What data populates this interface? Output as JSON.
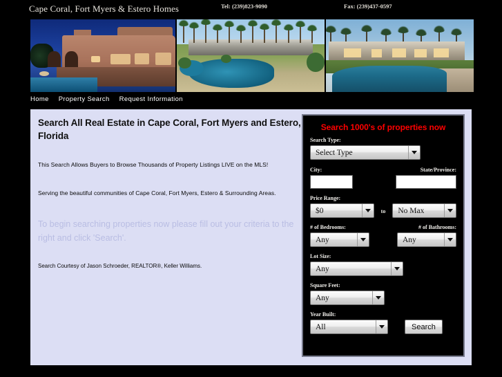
{
  "header": {
    "site_title": "Cape Coral, Fort Myers & Estero Homes",
    "tel": "Tel: (239)823-9090",
    "fax": "Fax: (239)437-0597"
  },
  "banner": {
    "photos": [
      {
        "alt": "adobe-style-home-at-dusk-with-pool"
      },
      {
        "alt": "palm-tree-estate-with-lagoon-pool"
      },
      {
        "alt": "modern-estate-at-twilight-with-lit-pool"
      }
    ]
  },
  "nav": {
    "items": [
      {
        "label": "Home"
      },
      {
        "label": "Property Search"
      },
      {
        "label": "Request Information"
      }
    ]
  },
  "main": {
    "heading": "Search All Real Estate in Cape Coral, Fort Myers and Estero, Florida",
    "line1": "This Search Allows Buyers to Browse Thousands of Property Listings LIVE on the MLS!",
    "line2": "Serving the beautiful communities of Cape Coral, Fort Myers, Estero & Surrounding Areas.",
    "callout": "To begin searching properties now please fill out your criteria to the right and click 'Search'.",
    "courtesy": "Search Courtesy of Jason Schroeder, REALTOR®, Keller Williams."
  },
  "search_form": {
    "title": "Search 1000's of properties now",
    "accent_color": "#ff0000",
    "panel_bg": "#000000",
    "fields": {
      "search_type": {
        "label": "Search Type:",
        "value": "Select Type"
      },
      "city": {
        "label": "City:",
        "value": "",
        "placeholder": ""
      },
      "state": {
        "label": "State/Province:",
        "value": "",
        "placeholder": ""
      },
      "price_range": {
        "label": "Price Range:",
        "min_value": "$0",
        "separator": "to",
        "max_value": "No Max"
      },
      "bedrooms": {
        "label": "# of Bedrooms:",
        "value": "Any"
      },
      "bathrooms": {
        "label": "# of Bathrooms:",
        "value": "Any"
      },
      "lot_size": {
        "label": "Lot Size:",
        "value": "Any"
      },
      "square_feet": {
        "label": "Square Feet:",
        "value": "Any"
      },
      "year_built": {
        "label": "Year Built:",
        "value": "All"
      }
    },
    "submit_label": "Search"
  }
}
